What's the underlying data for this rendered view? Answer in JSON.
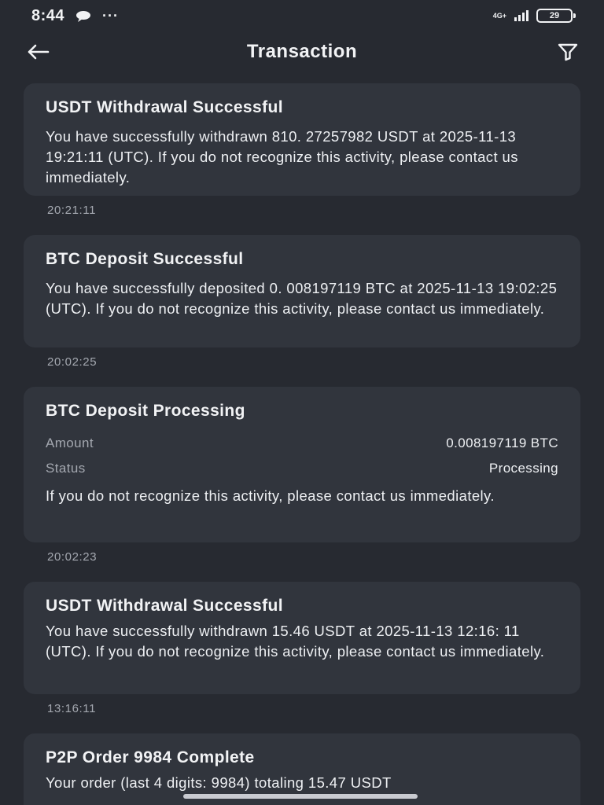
{
  "status_bar": {
    "time": "8:44",
    "dots": "···",
    "network": "4G+",
    "battery": "29"
  },
  "header": {
    "title": "Transaction"
  },
  "items": [
    {
      "title": "USDT Withdrawal Successful",
      "body": "You have successfully withdrawn 810. 27257982 USDT at 2025-11-13 19:21:11 (UTC). If you do not recognize this activity, please contact us immediately.",
      "time": "20:21:11"
    },
    {
      "title": "BTC Deposit Successful",
      "body": "You have successfully deposited 0. 008197119 BTC at 2025-11-13 19:02:25 (UTC). If you do not recognize this activity, please contact us immediately.",
      "time": "20:02:25"
    },
    {
      "title": "BTC Deposit Processing",
      "amount_label": "Amount",
      "amount_value": "0.008197119 BTC",
      "status_label": "Status",
      "status_value": "Processing",
      "note": "If you do not recognize this activity, please contact us immediately.",
      "time": "20:02:23"
    },
    {
      "title": "USDT Withdrawal Successful",
      "body": "You have successfully withdrawn 15.46 USDT at 2025-11-13 12:16: 11 (UTC). If you do not recognize this activity, please contact us immediately.",
      "time": "13:16:11"
    },
    {
      "title": "P2P Order 9984 Complete",
      "body": "Your order (last 4 digits: 9984) totaling 15.47 USDT"
    }
  ],
  "colors": {
    "background": "#272a31",
    "card": "#31353d",
    "text": "#f2f3f5",
    "muted": "#a4a8b0"
  }
}
